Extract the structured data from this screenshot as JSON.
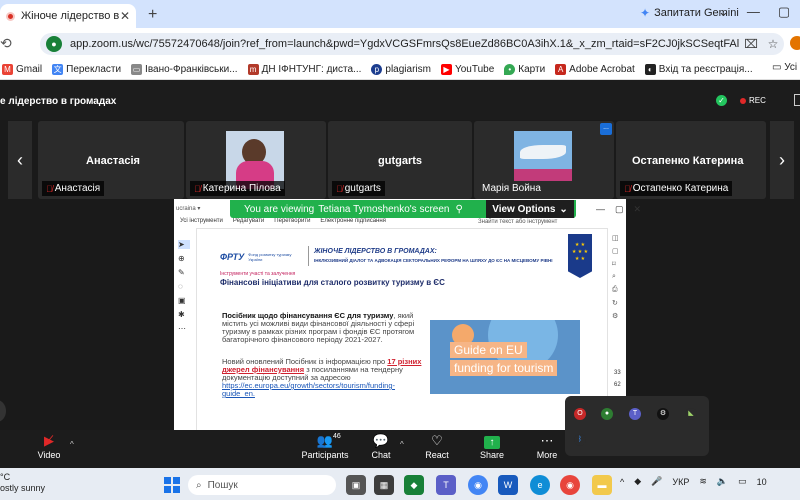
{
  "browser": {
    "tab_title": "Жіноче лідерство в громад",
    "new_tab": "+",
    "gemini_label": "Запитати Gemini",
    "url": "app.zoom.us/wc/75572470648/join?ref_from=launch&pwd=YgdxVCGSFmrsQs8EueZd86BC0A3ihX.1&_x_zm_rtaid=sF2CJ0jkSCSeqtFAlrifvA.1780939135273...",
    "bookmarks": [
      "Gmail",
      "Перекласти",
      "Івано-Франківськи...",
      "ДН ІФНТУНГ: диста...",
      "plagiarism",
      "YouTube",
      "Карти",
      "Adobe Acrobat",
      "Вхід та реєстрація..."
    ],
    "all_bookmarks": "Усі",
    "colors": {
      "tab_strip": "#d3e3fd",
      "omnibox": "#e9eef6"
    }
  },
  "meeting": {
    "title": "е лідерство в громадах",
    "rec_label": "REC",
    "tiles": [
      {
        "display": "Анастасія",
        "label": "Анастасія"
      },
      {
        "display": "",
        "label": "Катерина Пілова"
      },
      {
        "display": "gutgarts",
        "label": "gutgarts"
      },
      {
        "display": "",
        "label": "Марія Война"
      },
      {
        "display": "Остапенко Катерина",
        "label": "Остапенко Катерина"
      }
    ],
    "more_badge": "..."
  },
  "share": {
    "banner_prefix": "You are viewing",
    "presenter": "Tetiana Tymoshenko's screen",
    "view_options": "View Options",
    "pdf_menu": [
      "Усі інструменти",
      "Редагувати",
      "Перетворити",
      "Електронне підписання"
    ],
    "pdf_search": "Знайти текст або інструмент",
    "pdf_tabs": "ucraina ▾",
    "page_numbers": [
      "33",
      "62"
    ],
    "slide": {
      "logo": "ФРТУ",
      "logo_sub": "Фонд розвитку туризму України",
      "headline": "ЖІНОЧЕ ЛІДЕРСТВО В ГРОМАДАХ:",
      "subline": "ІНКЛЮЗИВНИЙ ДІАЛОГ ТА АДВОКАЦІЯ СЕКТОРАЛЬНИХ РЕФОРМ НА ШЛЯХУ ДО ЄС НА МІСЦЕВОМУ РІВНІ",
      "kicker": "Інструменти участі та залучення",
      "title": "Фінансові ініціативи для сталого розвитку туризму в ЄС",
      "para1_bold": "Посібник щодо фінансування ЄС для туризму",
      "para1_rest": ", який містить усі можливі види фінансової діяльності у сфері туризму в рамках різних програм і фондів ЄС протягом багаторічного фінансового періоду 2021-2027.",
      "para2_pre": "Новий оновлений Посібник із інформацією про",
      "para2_hl": "17 різних джерел фінансування",
      "para2_mid": "з посиланнями на тендерну документацію доступний за адресою",
      "para2_link": "https://ec.europa.eu/growth/sectors/tourism/funding-guide_en.",
      "promo_line1": "Guide on EU",
      "promo_line2": "funding for tourism"
    }
  },
  "toolbar": {
    "video": "Video",
    "participants": "Participants",
    "participants_count": "46",
    "chat": "Chat",
    "react": "React",
    "share": "Share",
    "more": "More"
  },
  "taskbar": {
    "temp": "°C",
    "weather": "ostly sunny",
    "search": "Пошук",
    "lang": "УКР",
    "clock": "10"
  }
}
